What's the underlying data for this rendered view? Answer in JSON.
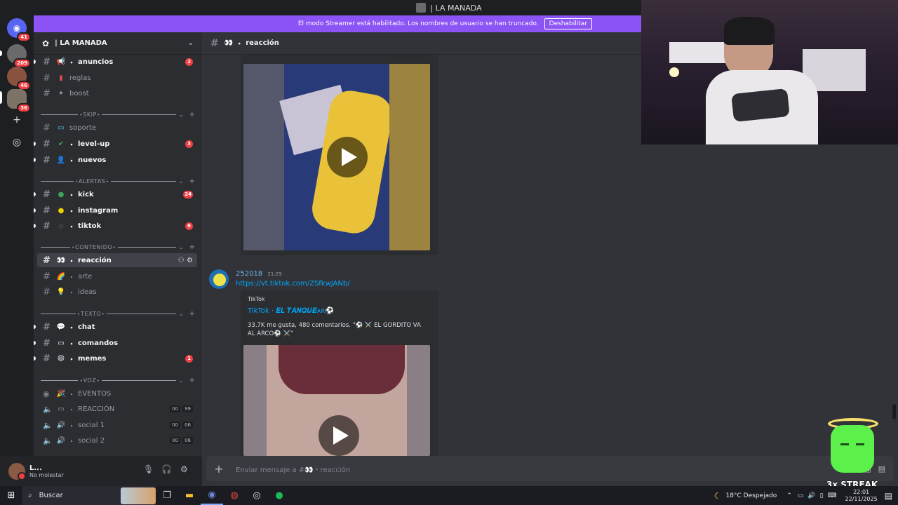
{
  "window": {
    "title": "| LA MANADA"
  },
  "banner": {
    "text": "El modo Streamer está habilitado. Los nombres de usuario se han truncado.",
    "button_label": "Deshabilitar",
    "color": "#8c54f5"
  },
  "guilds": [
    {
      "icon": "discord-home-icon",
      "badge": "41"
    },
    {
      "icon": "server-icon",
      "badge": "209"
    },
    {
      "icon": "server-icon",
      "badge": "46"
    },
    {
      "icon": "server-icon",
      "badge": "36"
    }
  ],
  "server": {
    "name": "| LA MANADA"
  },
  "channels": {
    "anuncios": {
      "label": "anuncios",
      "mention": "2"
    },
    "reglas": {
      "label": "reglas"
    },
    "boost": {
      "label": "boost"
    },
    "cat_skip": "⋆SKIP⋆",
    "soporte": {
      "label": "soporte"
    },
    "levelup": {
      "label": "level-up",
      "mention": "3"
    },
    "nuevos": {
      "label": "nuevos"
    },
    "cat_alertas": "⋆ALERTAS⋆",
    "kick": {
      "label": "kick",
      "mention": "24"
    },
    "instagram": {
      "label": "instagram"
    },
    "tiktok": {
      "label": "tiktok",
      "mention": "6"
    },
    "cat_contenido": "⋆CONTENIDO⋆",
    "reaccion": {
      "label": "reacción"
    },
    "arte": {
      "label": "arte"
    },
    "ideas": {
      "label": "ideas"
    },
    "cat_texto": "⋆TEXTO⋆",
    "chat": {
      "label": "chat"
    },
    "comandos": {
      "label": "comandos"
    },
    "memes": {
      "label": "memes",
      "mention": "1"
    },
    "cat_voz": "⋆VOZ⋆",
    "eventos": {
      "label": "EVENTOS"
    },
    "reaccion_voice": {
      "label": "REACCIÓN",
      "timer": [
        "00",
        "99"
      ]
    },
    "social1": {
      "label": "social 1",
      "timer": [
        "00",
        "06"
      ]
    },
    "social2": {
      "label": "social 2",
      "timer": [
        "00",
        "06"
      ]
    }
  },
  "user": {
    "name": "L...",
    "status": "No molestar"
  },
  "chat": {
    "channel_name": "reacción",
    "message": {
      "author": "252018",
      "time": "21:29",
      "link": "https://vt.tiktok.com/ZSfkwJANb/",
      "embed": {
        "provider": "TikTok",
        "title": "TikTok · 𝑬𝑳 𝑻𝑨𝑵𝑸𝑼𝑬ᴀʀ⚽",
        "description": "33.7K me gusta, 480 comentarios. \"⚽ ⚔️ EL GORDITO VA AL ARCO⚽ ⚔️\""
      }
    },
    "composer_placeholder": "Enviar mensaje a #👀・reacción"
  },
  "streak": {
    "label": "3x STREAK"
  },
  "taskbar": {
    "search_placeholder": "Buscar",
    "weather": "18°C  Despejado",
    "time": "22:01",
    "date": "22/11/2025"
  }
}
